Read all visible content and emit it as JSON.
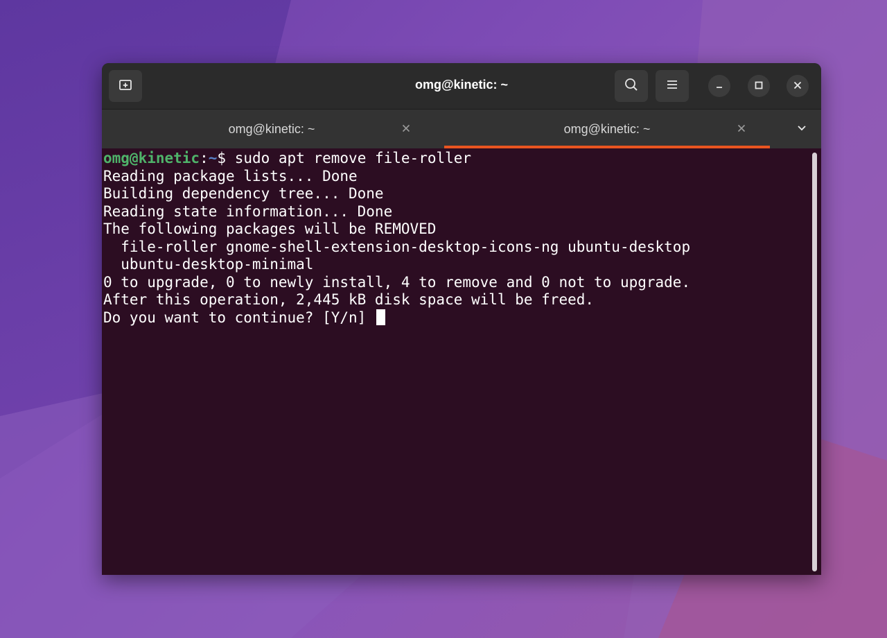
{
  "window": {
    "title": "omg@kinetic: ~",
    "new_tab_icon": "new-tab-icon",
    "search_icon": "search-icon",
    "menu_icon": "hamburger-menu-icon"
  },
  "tabs": [
    {
      "label": "omg@kinetic: ~",
      "active": false
    },
    {
      "label": "omg@kinetic: ~",
      "active": true
    }
  ],
  "colors": {
    "terminal_bg": "#2c0d22",
    "accent": "#e95420",
    "prompt_user": "#4fb36a",
    "prompt_path": "#5a82c8"
  },
  "terminal": {
    "prompt_user": "omg@kinetic",
    "prompt_sep": ":",
    "prompt_path": "~",
    "prompt_symbol": "$",
    "command": " sudo apt remove file-roller",
    "output": [
      "Reading package lists... Done",
      "Building dependency tree... Done",
      "Reading state information... Done",
      "The following packages will be REMOVED",
      "  file-roller gnome-shell-extension-desktop-icons-ng ubuntu-desktop",
      "  ubuntu-desktop-minimal",
      "0 to upgrade, 0 to newly install, 4 to remove and 0 not to upgrade.",
      "After this operation, 2,445 kB disk space will be freed."
    ],
    "question": "Do you want to continue? [Y/n] "
  }
}
